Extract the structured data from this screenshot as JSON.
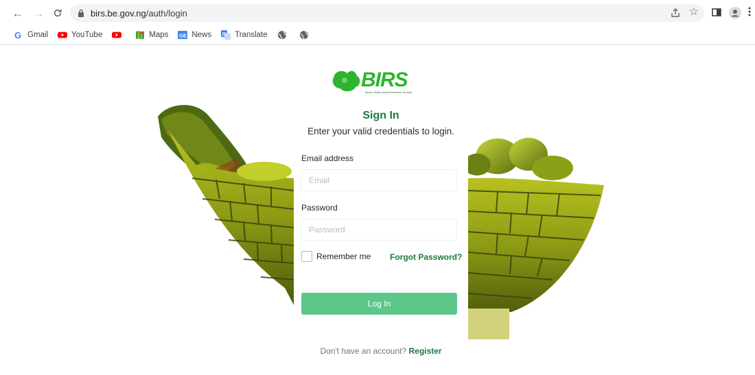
{
  "browser": {
    "url_host": "birs.be.gov.ng",
    "url_path": "/auth/login",
    "bookmarks": [
      {
        "label": "Gmail",
        "icon": "gmail-icon",
        "color": "#4285f4"
      },
      {
        "label": "YouTube",
        "icon": "youtube-icon",
        "color": "#ff0000"
      },
      {
        "label": "",
        "icon": "youtube-icon",
        "color": "#ff0000"
      },
      {
        "label": "Maps",
        "icon": "maps-icon",
        "color": "#34a853"
      },
      {
        "label": "News",
        "icon": "news-icon",
        "color": "#4285f4"
      },
      {
        "label": "Translate",
        "icon": "translate-icon",
        "color": "#4285f4"
      },
      {
        "label": "",
        "icon": "globe-icon",
        "color": "#5f6368"
      },
      {
        "label": "",
        "icon": "globe-icon",
        "color": "#5f6368"
      }
    ]
  },
  "logo": {
    "text": "BIRS",
    "tagline": "Benue State Internal Revenue Service",
    "color": "#2db52d"
  },
  "login": {
    "title": "Sign In",
    "subtitle": "Enter your valid credentials to login.",
    "email_label": "Email address",
    "email_placeholder": "Email",
    "email_value": "",
    "password_label": "Password",
    "password_placeholder": "Password",
    "password_value": "",
    "remember_label": "Remember me",
    "remember_checked": false,
    "forgot_label": "Forgot Password?",
    "submit_label": "Log In",
    "no_account_text": "Don't have an account?",
    "register_label": "Register"
  },
  "colors": {
    "accent": "#1b7a3c",
    "button": "#5dc78a"
  }
}
